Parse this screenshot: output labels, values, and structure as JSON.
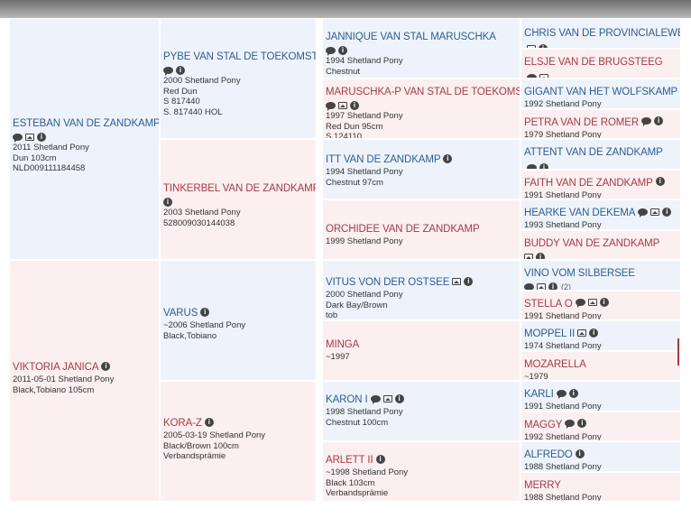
{
  "gen1": [
    {
      "name": "ESTEBAN VAN DE ZANDKAMP",
      "icons": [
        "chat-icon",
        "photo-icon",
        "info-icon"
      ],
      "lines": [
        "2011 Shetland Pony",
        "Dun 103cm",
        "NLD009111184458"
      ]
    },
    {
      "name": "VIKTORIA JANICA",
      "icons": [
        "info-icon"
      ],
      "lines": [
        "2011-05-01 Shetland Pony",
        "Black,Tobiano 105cm"
      ]
    }
  ],
  "gen2": [
    {
      "name": "PYBE VAN STAL DE TOEKOMST",
      "icons": [
        "chat-icon",
        "info-icon"
      ],
      "lines": [
        "2000 Shetland Pony",
        "Red Dun",
        "S 817440",
        "S. 817440 HOL"
      ]
    },
    {
      "name": "TINKERBEL VAN DE ZANDKAMP",
      "icons": [
        "info-icon"
      ],
      "lines": [
        "2003 Shetland Pony",
        "528009030144038"
      ]
    },
    {
      "name": "VARUS",
      "icons": [
        "info-icon"
      ],
      "lines": [
        "~2006 Shetland Pony",
        "Black,Tobiano"
      ]
    },
    {
      "name": "KORA-Z",
      "icons": [
        "info-icon"
      ],
      "lines": [
        "2005-03-19 Shetland Pony",
        "Black/Brown 100cm",
        "Verbandsprämie"
      ]
    }
  ],
  "gen3": [
    {
      "name": "JANNIQUE VAN STAL MARUSCHKA",
      "icons": [
        "chat-icon",
        "info-icon"
      ],
      "lines": [
        "1994 Shetland Pony",
        "Chestnut",
        "S 806491"
      ]
    },
    {
      "name": "MARUSCHKA-P VAN STAL DE TOEKOMST",
      "icons": [
        "chat-icon",
        "photo-icon",
        "info-icon"
      ],
      "lines": [
        "1997 Shetland Pony",
        "Red Dun 95cm",
        "S 124110"
      ]
    },
    {
      "name": "ITT VAN DE ZANDKAMP",
      "icons": [
        "info-icon"
      ],
      "lines": [
        "1994 Shetland Pony",
        "Chestnut 97cm"
      ]
    },
    {
      "name": "ORCHIDEE VAN DE ZANDKAMP",
      "icons": [],
      "lines": [
        "1999 Shetland Pony"
      ]
    },
    {
      "name": "VITUS VON DER OSTSEE",
      "icons": [
        "photo-icon",
        "info-icon"
      ],
      "lines": [
        "2000 Shetland Pony",
        "Dark Bay/Brown",
        "tob"
      ]
    },
    {
      "name": "MINGA",
      "icons": [],
      "lines": [
        "~1997"
      ]
    },
    {
      "name": "KARON I",
      "icons": [
        "chat-icon",
        "photo-icon",
        "info-icon"
      ],
      "lines": [
        "1998 Shetland Pony",
        "Chestnut 100cm"
      ]
    },
    {
      "name": "ARLETT II",
      "icons": [
        "info-icon"
      ],
      "lines": [
        "~1998 Shetland Pony",
        "Black 103cm",
        "Verbandsprämie"
      ]
    }
  ],
  "gen4": [
    {
      "name": "CHRIS VAN DE PROVINCIALEWEG",
      "icons": [
        "photo-icon",
        "info-icon"
      ],
      "lines": [
        "1988 Shetland Pony"
      ]
    },
    {
      "name": "ELSJE VAN DE BRUGSTEEG",
      "icons": [
        "chat-icon",
        "photo-icon"
      ],
      "lines": [
        "1990 Shetland Pony"
      ]
    },
    {
      "name": "GIGANT VAN HET WOLFSKAMP",
      "icons": [],
      "lines": [
        "1992 Shetland Pony"
      ]
    },
    {
      "name": "PETRA VAN DE ROMER",
      "icons": [
        "chat-icon",
        "info-icon"
      ],
      "lines": [
        "1979 Shetland Pony"
      ]
    },
    {
      "name": "ATTENT VAN DE ZANDKAMP",
      "icons": [
        "chat-icon",
        "info-icon"
      ],
      "lines": [
        "1986 Shetland Pony"
      ]
    },
    {
      "name": "FAITH VAN DE ZANDKAMP",
      "icons": [
        "info-icon"
      ],
      "lines": [
        "1991 Shetland Pony"
      ]
    },
    {
      "name": "HEARKE VAN DEKEMA",
      "icons": [
        "chat-icon",
        "photo-icon",
        "info-icon"
      ],
      "lines": [
        "1993 Shetland Pony"
      ]
    },
    {
      "name": "BUDDY VAN DE ZANDKAMP",
      "icons": [
        "photo-icon",
        "info-icon"
      ],
      "lines": [
        "1987 Shetland Pony"
      ]
    },
    {
      "name": "VINO VOM SILBERSEE",
      "icons": [
        "chat-icon",
        "photo-icon",
        "info-icon"
      ],
      "photo_count": "(2)",
      "lines": [
        "1995 Shetland Pony"
      ]
    },
    {
      "name": "STELLA O",
      "icons": [
        "chat-icon",
        "photo-icon",
        "info-icon"
      ],
      "lines": [
        "1991 Shetland Pony"
      ]
    },
    {
      "name": "MOPPEL II",
      "icons": [
        "photo-icon",
        "info-icon"
      ],
      "lines": [
        "1974 Shetland Pony"
      ]
    },
    {
      "name": "MOZARELLA",
      "icons": [],
      "lines": [
        "~1979"
      ]
    },
    {
      "name": "KARLI",
      "icons": [
        "chat-icon",
        "info-icon"
      ],
      "lines": [
        "1991 Shetland Pony"
      ]
    },
    {
      "name": "MAGGY",
      "icons": [
        "chat-icon",
        "info-icon"
      ],
      "lines": [
        "1992 Shetland Pony"
      ]
    },
    {
      "name": "ALFREDO",
      "icons": [
        "info-icon"
      ],
      "lines": [
        "1988 Shetland Pony"
      ]
    },
    {
      "name": "MERRY",
      "icons": [],
      "lines": [
        "1988 Shetland Pony"
      ]
    }
  ]
}
